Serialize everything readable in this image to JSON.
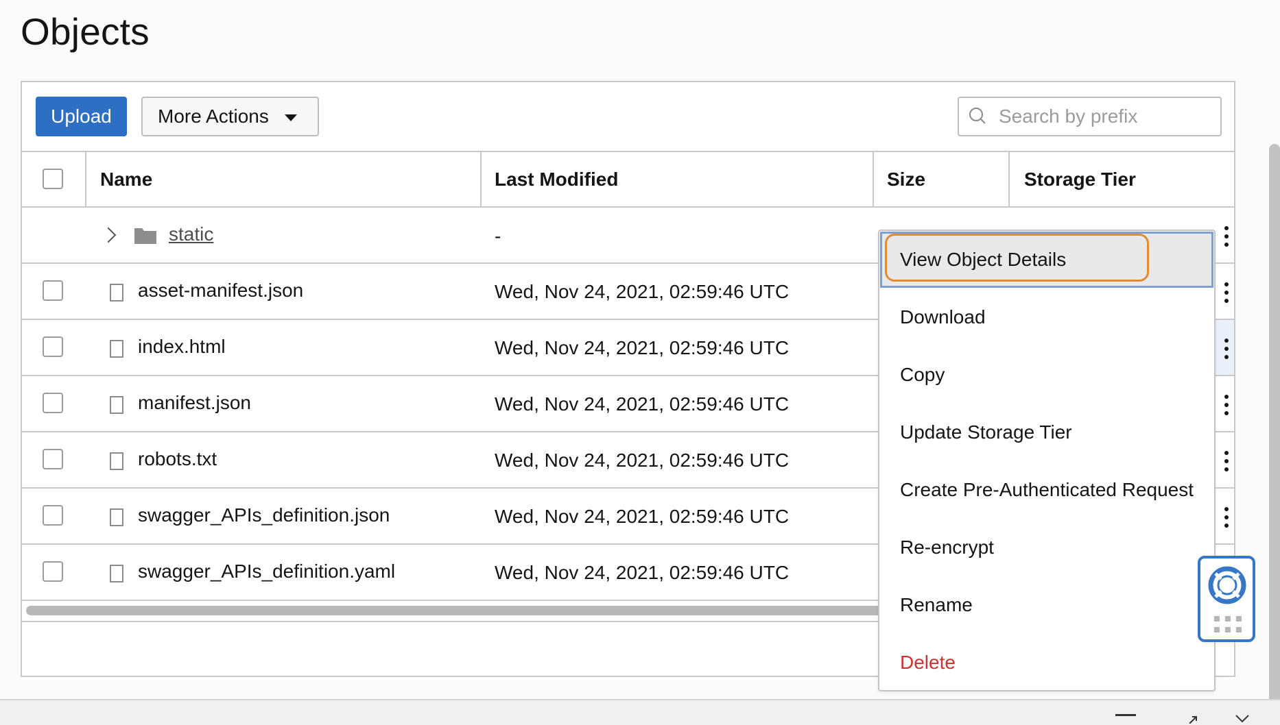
{
  "page": {
    "title": "Objects"
  },
  "toolbar": {
    "upload_label": "Upload",
    "more_actions_label": "More Actions",
    "search_placeholder": "Search by prefix",
    "search_value": ""
  },
  "table": {
    "columns": [
      "Name",
      "Last Modified",
      "Size",
      "Storage Tier"
    ],
    "folder": {
      "name": "static",
      "last_modified": "-"
    },
    "rows": [
      {
        "name": "asset-manifest.json",
        "last_modified": "Wed, Nov 24, 2021, 02:59:46 UTC"
      },
      {
        "name": "index.html",
        "last_modified": "Wed, Nov 24, 2021, 02:59:46 UTC"
      },
      {
        "name": "manifest.json",
        "last_modified": "Wed, Nov 24, 2021, 02:59:46 UTC"
      },
      {
        "name": "robots.txt",
        "last_modified": "Wed, Nov 24, 2021, 02:59:46 UTC"
      },
      {
        "name": "swagger_APIs_definition.json",
        "last_modified": "Wed, Nov 24, 2021, 02:59:46 UTC"
      },
      {
        "name": "swagger_APIs_definition.yaml",
        "last_modified": "Wed, Nov 24, 2021, 02:59:46 UTC"
      }
    ]
  },
  "context_menu": {
    "items": [
      "View Object Details",
      "Download",
      "Copy",
      "Update Storage Tier",
      "Create Pre-Authenticated Request",
      "Re-encrypt",
      "Rename",
      "Delete"
    ],
    "active_index": 0,
    "danger_index": 7
  },
  "colors": {
    "primary": "#2d6fc2",
    "focus_ring": "#e08b37",
    "danger": "#d0312d",
    "help_widget": "#3676c4"
  },
  "icons": [
    "search-icon",
    "caret-down-icon",
    "chevron-right-icon",
    "folder-icon",
    "file-icon",
    "kebab-icon",
    "lifebuoy-icon",
    "grid-icon"
  ]
}
